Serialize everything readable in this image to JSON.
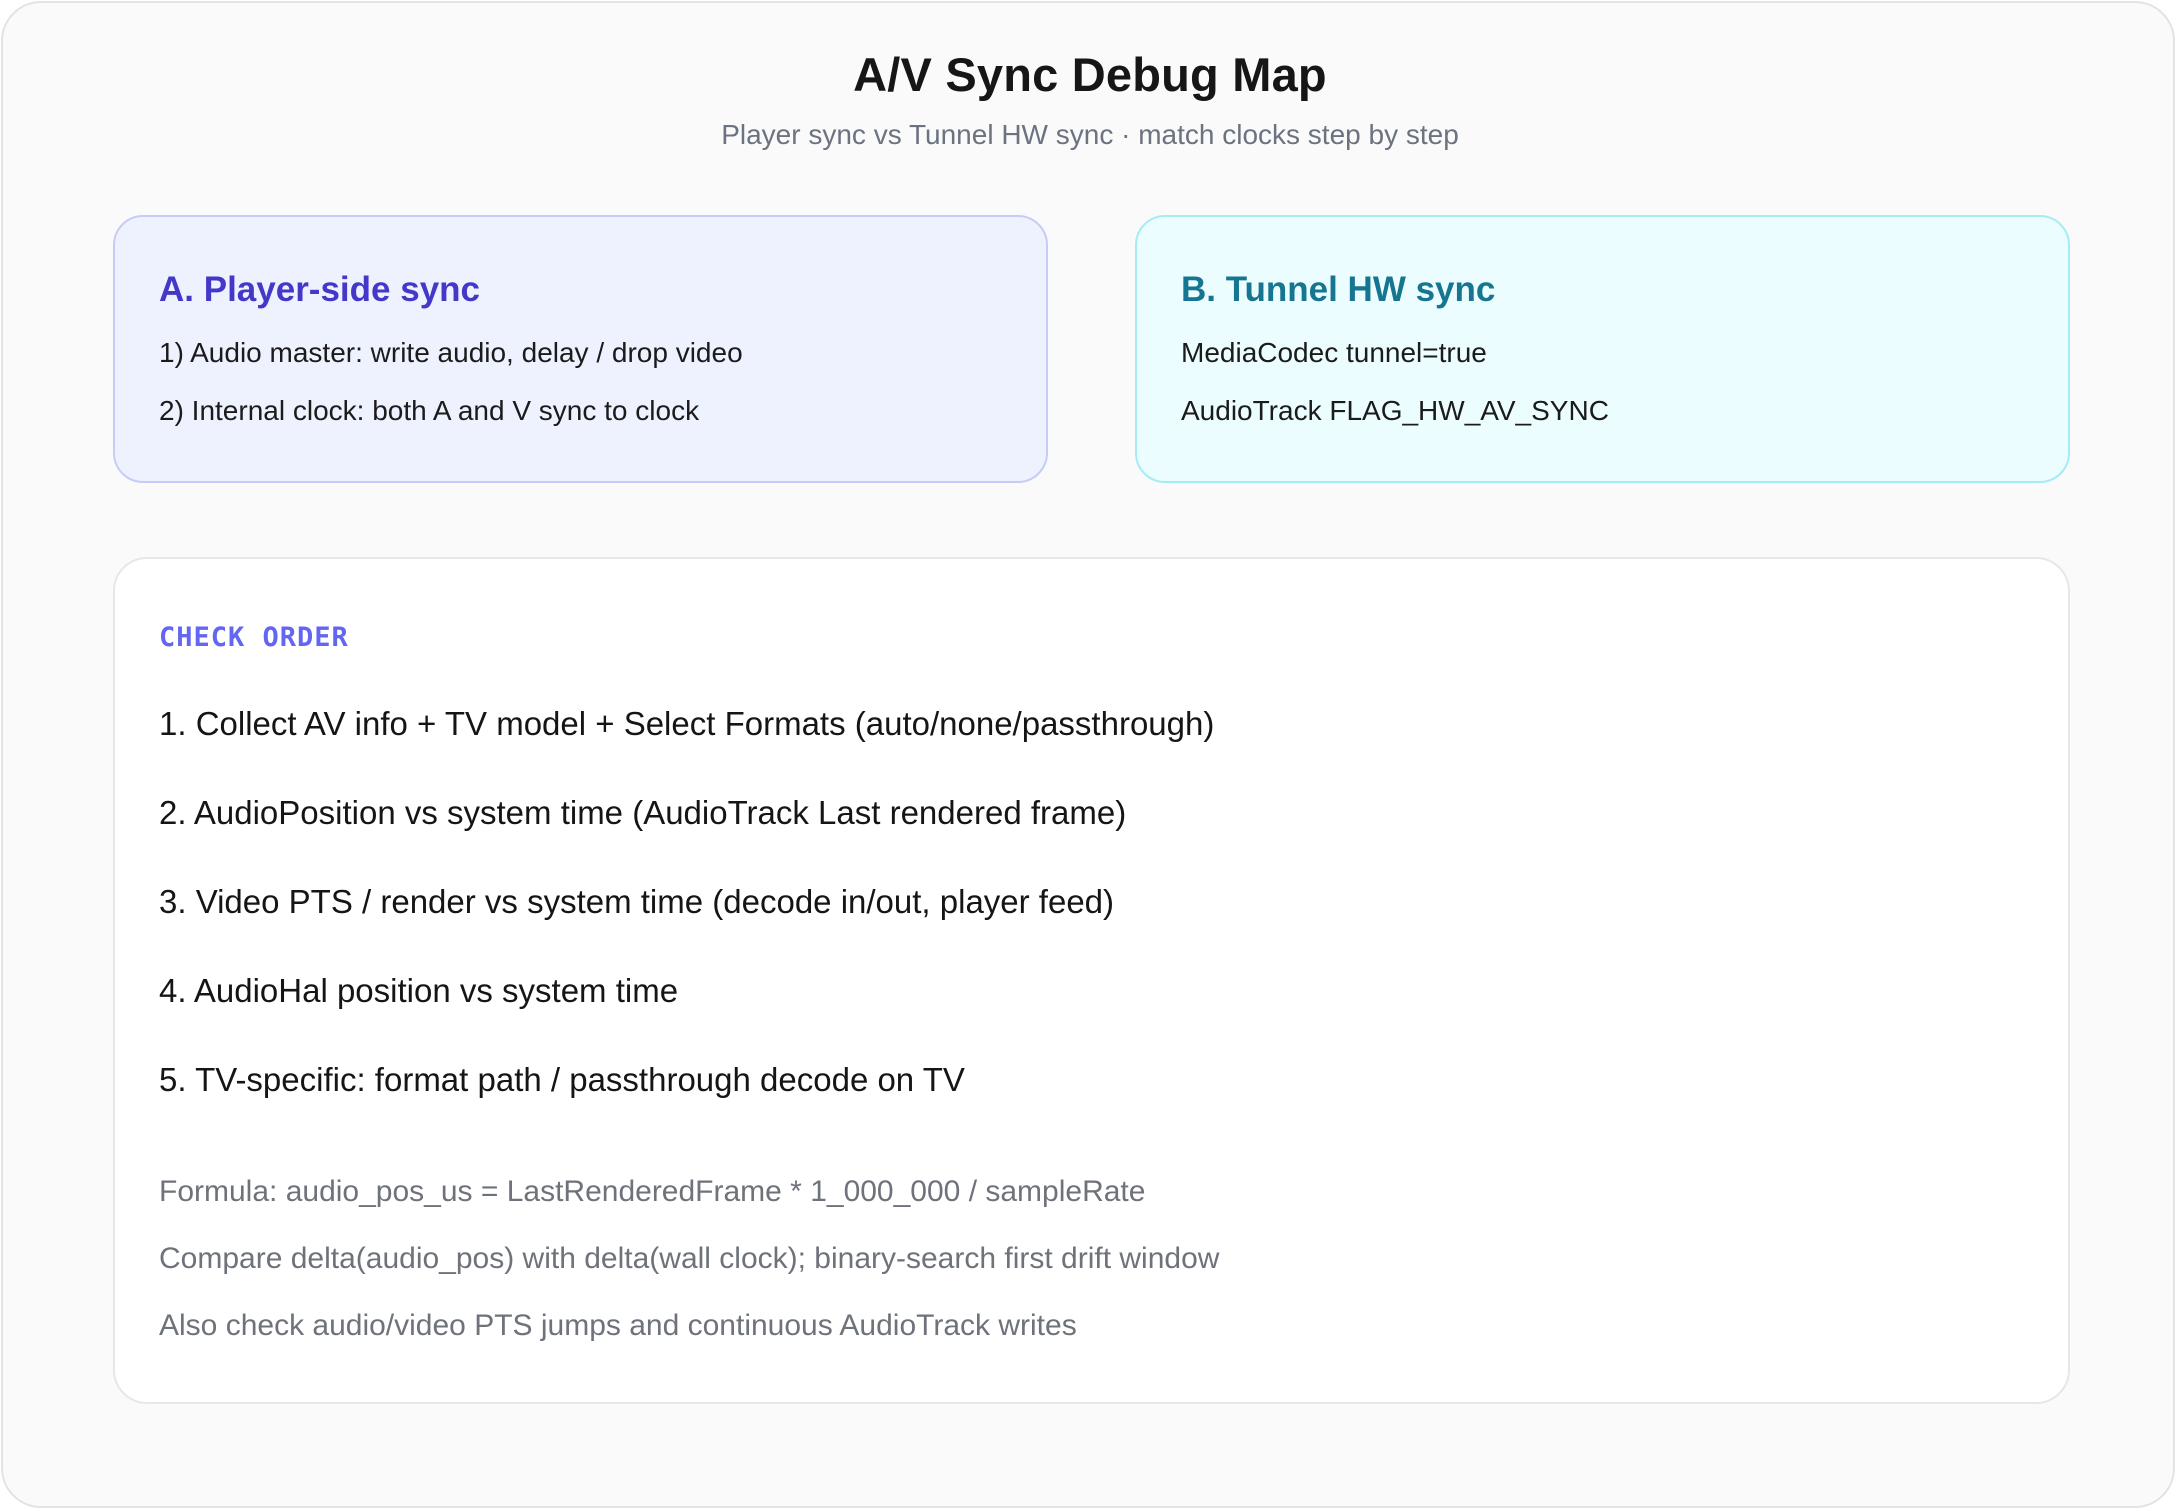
{
  "header": {
    "title": "A/V Sync Debug Map",
    "subtitle": "Player sync vs Tunnel HW sync · match clocks step by step"
  },
  "player_sync": {
    "title": "A. Player-side sync",
    "lines": [
      "1) Audio master: write audio, delay / drop video",
      "2) Internal clock: both A and V sync to clock"
    ]
  },
  "tunnel_sync": {
    "title": "B. Tunnel HW sync",
    "lines": [
      "MediaCodec tunnel=true",
      "AudioTrack FLAG_HW_AV_SYNC"
    ]
  },
  "check_order": {
    "label": "CHECK ORDER",
    "steps": [
      "1. Collect AV info + TV model + Select Formats (auto/none/passthrough)",
      "2. AudioPosition vs system time (AudioTrack Last rendered frame)",
      "3. Video PTS / render vs system time (decode in/out, player feed)",
      "4. AudioHal position vs system time",
      "5. TV-specific: format path / passthrough decode on TV"
    ],
    "notes": [
      "Formula: audio_pos_us = LastRenderedFrame * 1_000_000 / sampleRate",
      "Compare delta(audio_pos) with delta(wall clock); binary-search first drift window",
      "Also check audio/video PTS jumps and continuous AudioTrack writes"
    ]
  },
  "colors": {
    "player_accent": "#4438c9",
    "tunnel_accent": "#167590",
    "check_label": "#6366f1"
  }
}
